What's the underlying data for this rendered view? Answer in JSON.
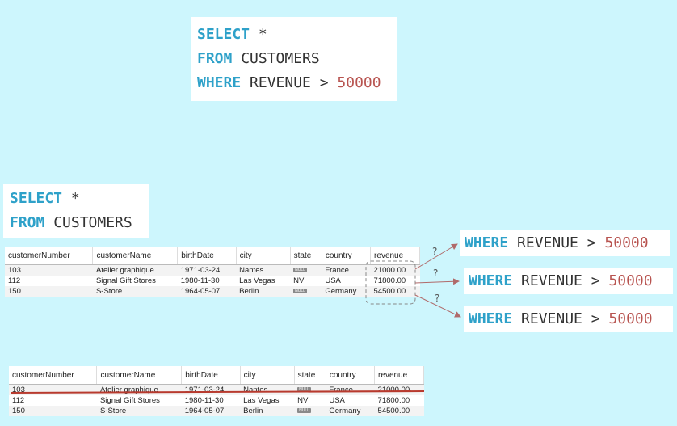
{
  "query_full": {
    "select_kw": "SELECT",
    "select_rest": " *",
    "from_kw": "FROM",
    "from_rest": " CUSTOMERS",
    "where_kw": "WHERE",
    "where_rest": " REVENUE > ",
    "where_value": "50000"
  },
  "query_partial": {
    "select_kw": "SELECT",
    "select_rest": " *",
    "from_kw": "FROM",
    "from_rest": " CUSTOMERS"
  },
  "where_clause": {
    "kw": "WHERE",
    "rest": " REVENUE > ",
    "value": "50000"
  },
  "question_mark": "?",
  "table": {
    "columns": [
      "customerNumber",
      "customerName",
      "birthDate",
      "city",
      "state",
      "country",
      "revenue"
    ],
    "rows": [
      [
        "103",
        "Atelier graphique",
        "1971-03-24",
        "Nantes",
        "NULL",
        "France",
        "21000.00"
      ],
      [
        "112",
        "Signal Gift Stores",
        "1980-11-30",
        "Las Vegas",
        "NV",
        "USA",
        "71800.00"
      ],
      [
        "150",
        "S-Store",
        "1964-05-07",
        "Berlin",
        "NULL",
        "Germany",
        "54500.00"
      ]
    ]
  },
  "colors": {
    "background": "#cdf6fd",
    "keyword": "#2ea1c9",
    "number": "#b85450",
    "strike": "#b83a2e",
    "arrow": "#b06a6a"
  }
}
